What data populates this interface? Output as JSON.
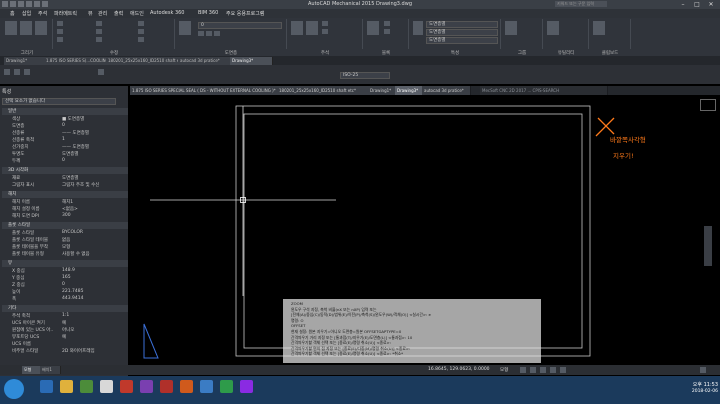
{
  "window": {
    "title": "AutoCAD Mechanical 2015    Drawing3.dwg",
    "search_placeholder": "키워드 또는 구문 입력"
  },
  "menu": [
    "홈",
    "삽입",
    "주석",
    "파라메트릭",
    "뷰",
    "관리",
    "출력",
    "애드인",
    "Autodesk 360",
    "BIM 360",
    "주요 응용프로그램"
  ],
  "ribbon": {
    "groups": [
      "그리기",
      "수정",
      "도면층",
      "주석",
      "블록",
      "특성",
      "그룹",
      "유틸리티",
      "클립보드"
    ],
    "layer_combo": "0",
    "color_combo": "도면층별",
    "linetype_combo": "도면층별",
    "lineweight_combo": "도면층별"
  },
  "file_tabs": [
    "Drawing1*",
    "1.875 ISO SERIES S(...COOLING )*",
    "180201_25x25x160_ID2510 shaft etc*",
    "autocad 3d pratice*",
    "Drawing3*"
  ],
  "style_combo": "ISO-25",
  "doc_tabs": [
    "1.875 ISO SERIES SPECIAL SEAL ( DS - WITHOUT EXTERNAL COOLING )*",
    "180201_25x25x160_ID2510 shaft etc*",
    "Drawing1*",
    "Drawing3*",
    "autocad 3d pratice*"
  ],
  "doc_tab_side": "MecSoft CNC 2D 2017  ...  CPIS-SEARCH",
  "properties": {
    "header": "특성",
    "selection": "선택 요소가 없습니다",
    "sections": [
      {
        "title": "일반",
        "rows": [
          [
            "색상",
            "■ 도면층별"
          ],
          [
            "도면층",
            "0"
          ],
          [
            "선종류",
            "—— 도면층별"
          ],
          [
            "선종류 축척",
            "1"
          ],
          [
            "선가중치",
            "—— 도면층별"
          ],
          [
            "투명도",
            "도면층별"
          ],
          [
            "두께",
            "0"
          ]
        ]
      },
      {
        "title": "3D 시각화",
        "rows": [
          [
            "재료",
            "도면층별"
          ],
          [
            "그림자 표시",
            "그림자 주조 및 수신"
          ]
        ]
      },
      {
        "title": "해치",
        "rows": [
          [
            "해치 이름",
            "해치1"
          ],
          [
            "해치 설정 이름",
            "<없음>"
          ],
          [
            "해치 도면 DPI",
            "300"
          ]
        ]
      },
      {
        "title": "플롯 스타일",
        "rows": [
          [
            "플롯 스타일",
            "BYCOLOR"
          ],
          [
            "플롯 스타일 테이블",
            "없음"
          ],
          [
            "플롯 테이블을 부착",
            "모형"
          ],
          [
            "플롯 테이블 유형",
            "사용할 수 없음"
          ]
        ]
      },
      {
        "title": "뷰",
        "rows": [
          [
            "X 중심",
            "148.9"
          ],
          [
            "Y 중심",
            "165"
          ],
          [
            "Z 중심",
            "0"
          ],
          [
            "높이",
            "221.7485"
          ],
          [
            "폭",
            "443.9414"
          ]
        ]
      },
      {
        "title": "기타",
        "rows": [
          [
            "주석 축척",
            "1:1"
          ],
          [
            "UCS 아이콘 켜기",
            "예"
          ],
          [
            "원점에 있는 UCS 아..",
            "아니오"
          ],
          [
            "뷰포트당 UCS",
            "예"
          ],
          [
            "UCS 이름",
            ""
          ],
          [
            "비주얼 스타일",
            "2D 와이어프레임"
          ]
        ]
      }
    ]
  },
  "annotation": {
    "text_line1": "바깥쪽사각형",
    "text_line2": "지우기!",
    "mark": "✕"
  },
  "command_lines": [
    "ZOOM",
    "윈도우 구석 지정, 축척 비율(nX 또는 nXP) 입력 또는",
    "[전체(A)/중심(C)/동적(D)/범위(E)/이전(P)/축척(S)/윈도우(W)/객체(O)] <실시간>: e",
    "명령: O",
    "OFFSET",
    "현재 설정: 원본 지우기=아니오  도면층=원본  OFFSETGAPTYPE=0",
    "간격띄우기 거리 지정 또는 [통과점(T)/지우기(E)/도면층(L)] <통과점>: 10",
    "간격띄우기할 객체 선택 또는 [종료(E)/명령 취소(U)] <종료>:",
    "간격띄우기할 면의 점 지정 또는 [종료(E)/다중(M)/명령 취소(U)] <종료>:",
    "간격띄우기할 객체 선택 또는 [종료(E)/명령 취소(U)] <종료>: *취소*"
  ],
  "model_tabs": [
    "모형",
    "배치1"
  ],
  "coords": "16.8645, 129.0623, 0.0000",
  "status_mode": "모형",
  "clock": {
    "time": "오후 11:53",
    "date": "2018-02-06"
  }
}
